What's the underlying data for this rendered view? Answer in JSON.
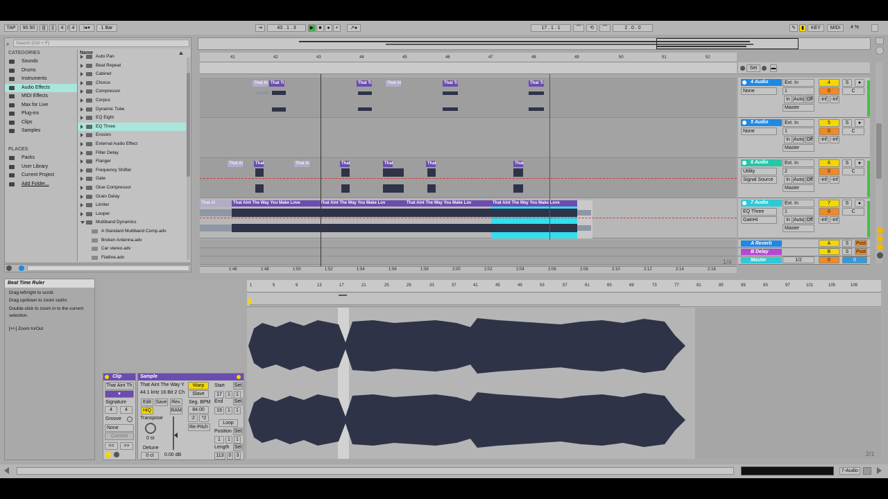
{
  "transport": {
    "tap": "TAP",
    "tempo": "90.50",
    "sig_num": "4",
    "sig_den": "4",
    "quantize": "1 Bar",
    "position": "43 .   1 .   3",
    "loop_start": "17 .   1 .   1",
    "loop_length": "2 .   0 .   0",
    "key": "KEY",
    "midi": "MIDI",
    "cpu": "4 %"
  },
  "browser": {
    "search_placeholder": "Search (Ctrl + F)",
    "categories_title": "CATEGORIES",
    "categories": [
      "Sounds",
      "Drums",
      "Instruments",
      "Audio Effects",
      "MIDI Effects",
      "Max for Live",
      "Plug-ins",
      "Clips",
      "Samples"
    ],
    "places_title": "PLACES",
    "places": [
      "Packs",
      "User Library",
      "Current Project",
      "Add Folder..."
    ],
    "name_header": "Name",
    "items": [
      "Auto Pan",
      "Beat Repeat",
      "Cabinet",
      "Chorus",
      "Compressor",
      "Corpus",
      "Dynamic Tube",
      "EQ Eight",
      "EQ Three",
      "Erosion",
      "External Audio Effect",
      "Filter Delay",
      "Flanger",
      "Frequency Shifter",
      "Gate",
      "Glue Compressor",
      "Grain Delay",
      "Limiter",
      "Looper",
      "Multiband Dynamics",
      "A Standard Multiband Comp.adv",
      "Broken Antenna.adv",
      "Car stereo.adv",
      "Flatline.adv"
    ]
  },
  "arrangement": {
    "ruler_bars": [
      "41",
      "42",
      "43",
      "44",
      "45",
      "46",
      "47",
      "48",
      "49",
      "50",
      "51",
      "52"
    ],
    "time_ruler": [
      "1:46",
      "1:48",
      "1:50",
      "1:52",
      "1:54",
      "1:56",
      "1:58",
      "2:00",
      "2:02",
      "2:04",
      "2:06",
      "2:08",
      "2:10",
      "2:12",
      "2:14",
      "2:16"
    ],
    "zoom_fraction": "1/4",
    "clip_short": "That Ai",
    "clip_mid": "That Ti",
    "clip_tiny": "That",
    "clip_full": "That Aint The Way You Make Love",
    "clip_full_short": "That Aint The Way You Make Lov",
    "set_label": "Set"
  },
  "tracks": [
    {
      "name": "4 Audio",
      "color": "#1e88e5",
      "num": "4",
      "input": "Ext. In",
      "chain": "None",
      "ch": "1",
      "out": "Master"
    },
    {
      "name": "5 Audio",
      "color": "#1e88e5",
      "num": "5",
      "input": "Ext. In",
      "chain": "None",
      "ch": "1",
      "out": "Master"
    },
    {
      "name": "6 Audio",
      "color": "#26c6a6",
      "num": "6",
      "input": "Ext. In",
      "chain": "Utility",
      "chain2": "Signal Source",
      "ch": "2",
      "out": "Master"
    },
    {
      "name": "7 Audio",
      "color": "#2ec9d6",
      "num": "7",
      "input": "Ext. In",
      "chain": "EQ Three",
      "chain2": "GainHi",
      "ch": "1",
      "out": "Master"
    }
  ],
  "returns": [
    {
      "name": "A Reverb",
      "color": "#1e88e5",
      "letter": "A"
    },
    {
      "name": "B Delay",
      "color": "#b34ad1",
      "letter": "B"
    },
    {
      "name": "Master",
      "color": "#2ec9d6",
      "letter": "0"
    }
  ],
  "mixer": {
    "in": "In",
    "auto": "Auto",
    "off": "Off",
    "solo": "S",
    "center": "C",
    "vol_inf": "-inf",
    "post": "Post",
    "master_fraction": "1/2",
    "master_zero": "0"
  },
  "info": {
    "title": "Beat Time Ruler",
    "lines": [
      "Drag left/right to scroll.",
      "Drag up/down to zoom out/in.",
      "Double-click to zoom in to the current selection."
    ],
    "zoom_hint": "[+/-] Zoom In/Out"
  },
  "clip_view": {
    "clip_header": "Clip",
    "sample_header": "Sample",
    "clip_name": "That Aint Th",
    "sample_name": "That Aint The Way Y",
    "sample_info": "44.1 kHz 16 Bit 2 Ch",
    "signature_label": "Signature",
    "sig_num": "4",
    "sig_den": "4",
    "groove_label": "Groove",
    "groove_value": "None",
    "commit": "Commit",
    "edit": "Edit",
    "save": "Save",
    "rev": "Rev.",
    "hiq": "HiQ",
    "ram": "RAM",
    "warp": "Warp",
    "slave": "Slave",
    "seg_bpm_label": "Seg. BPM",
    "seg_bpm": "84.00",
    "half": ":2",
    "double": "*2",
    "repitch": "Re-Pitch",
    "transpose_label": "Transpose",
    "transpose": "0 st",
    "detune_label": "Detune",
    "detune": "0 ct",
    "gain": "0.00 dB",
    "start_label": "Start",
    "start": [
      "17",
      "1",
      "1"
    ],
    "end_label": "End",
    "end": [
      "19",
      "1",
      "1"
    ],
    "loop": "Loop",
    "position_label": "Position",
    "position": [
      "1",
      "1",
      "1"
    ],
    "length_label": "Length",
    "length": [
      "113",
      "0",
      "3"
    ],
    "set": "Set",
    "ruler_marks": [
      "1",
      "5",
      "9",
      "13",
      "17",
      "21",
      "25",
      "29",
      "33",
      "37",
      "41",
      "45",
      "49",
      "53",
      "57",
      "61",
      "65",
      "69",
      "73",
      "77",
      "81",
      "85",
      "89",
      "93",
      "97",
      "101",
      "105",
      "109"
    ],
    "zoom_fraction": "2/1"
  },
  "status": {
    "track_label": "7-Audio"
  }
}
